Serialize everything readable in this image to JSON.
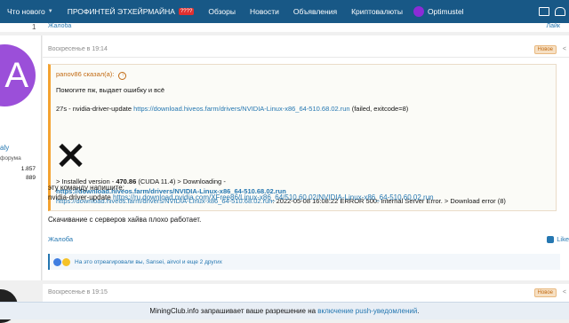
{
  "nav": {
    "items": [
      {
        "label": "Что нового"
      },
      {
        "label": "ПРОФИНТЕЙ ЭТХЕЙРМАЙНА",
        "badge": "????"
      },
      {
        "label": "Обзоры"
      },
      {
        "label": "Новости"
      },
      {
        "label": "Объявления"
      },
      {
        "label": "Криптовалюты"
      }
    ],
    "user": "Optimustel"
  },
  "prev_post": {
    "number": "1",
    "complain": "Жалоба",
    "like": "Лайк"
  },
  "sidebar": {
    "avatar_letter": "A",
    "name": "aly",
    "role": "форума",
    "stat1": "1.857",
    "stat2": "889"
  },
  "post": {
    "date": "Воскресенье в 19:14",
    "new_badge": "Новое",
    "share": "<",
    "quote": {
      "author": "panov86 сказал(а):",
      "author_arrow": "↑",
      "line1": "Помогите пж, выдает ошибку и всё",
      "line2_prefix": "27s - nvidia-driver-update ",
      "line2_link": "https://download.hiveos.farm/drivers/NVIDIA-Linux-x86_64-510.68.02.run",
      "line2_suffix": " (failed, exitcode=8)",
      "line3_prefix": "> Installed version - ",
      "line3_bold": "470.86",
      "line3_suffix": " (CUDA 11.4) > Downloading -",
      "line4_link": "https://download.hiveos.farm/drivers/NVIDIA-Linux-x86_64-510.68.02.run",
      "line5_link": "https://download.hiveos.farm/drivers/NVIDIA-Linux-x86_64-510.68.02.run",
      "line5_suffix": ": 2022-05-08 16:08:22 ERROR 500: Internal Server Error. > Download error (8)"
    },
    "line1": "эту команду напишите:",
    "line2_prefix": "nvidia-driver-update ",
    "line2_link": "https://ru.download.nvidia.com/XFree86/Linux-x86_64/510.60.02/NVIDIA-Linux-x86_64-510.60.02.run",
    "line3": "Скачивание с серверов хайва плохо работает.",
    "complain": "Жалоба",
    "like": "Like",
    "reactions_text": "На это отреагировали вы, Sansei, airvol и еще 2 других"
  },
  "post2": {
    "date": "Воскресенье в 19:15",
    "new_badge": "Новое",
    "share": "<"
  },
  "push": {
    "prefix": "MiningClub.info запрашивает ваше разрешение на ",
    "link": "включение push-уведомлений",
    "suffix": "."
  }
}
